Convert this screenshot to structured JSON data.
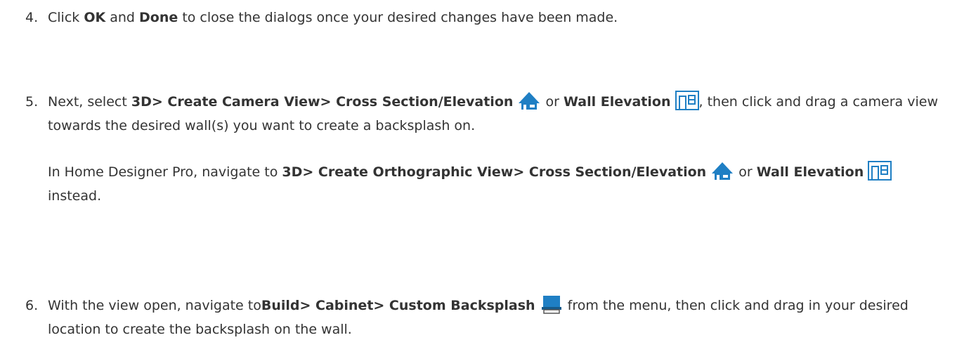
{
  "steps": [
    {
      "number": "4.",
      "t1": "Click ",
      "b1": "OK",
      "t2": " and ",
      "b2": "Done",
      "t3": " to close the dialogs once your desired changes have been made."
    },
    {
      "number": "5.",
      "t1": "Next, select ",
      "b1": "3D> Create Camera View> Cross Section/Elevation",
      "t2": " or ",
      "b2": "Wall Elevation",
      "t3": ", then click and drag a camera view towards the desired wall(s) you want to create a backsplash on.",
      "sub_t1": "In Home Designer Pro, navigate to ",
      "sub_b1": "3D> Create Orthographic View> Cross Section/Elevation",
      "sub_t2": " or ",
      "sub_b2": "Wall Elevation",
      "sub_t3": " instead."
    },
    {
      "number": "6.",
      "t1": "With the view open, navigate to",
      "b1": "Build> Cabinet> Custom Backsplash",
      "t2": " from the menu, then click and drag in your desired location to create the backsplash on the wall."
    }
  ],
  "icons": {
    "cross_section": "cross-section-elevation-icon",
    "wall_elevation": "wall-elevation-icon",
    "backsplash": "custom-backsplash-icon"
  },
  "colors": {
    "text": "#333333",
    "icon_blue": "#1f7fc4",
    "icon_dark": "#155a8a"
  }
}
